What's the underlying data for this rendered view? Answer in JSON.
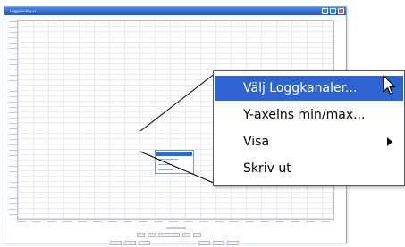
{
  "window": {
    "title": "Loggvisning.vi"
  },
  "context_menu": {
    "items": [
      {
        "label": "Välj Loggkanaler...",
        "highlighted": true
      },
      {
        "label": "Y-axelns min/max...",
        "highlighted": false
      },
      {
        "label": "Visa",
        "highlighted": false,
        "has_submenu": true
      },
      {
        "label": "Skriv ut",
        "highlighted": false
      }
    ]
  },
  "colors": {
    "highlight": "#2f63cf",
    "titlebar": "#2459c9"
  },
  "icons": {
    "cursor": "arrow-cursor-icon",
    "submenu": "triangle-right-icon"
  }
}
